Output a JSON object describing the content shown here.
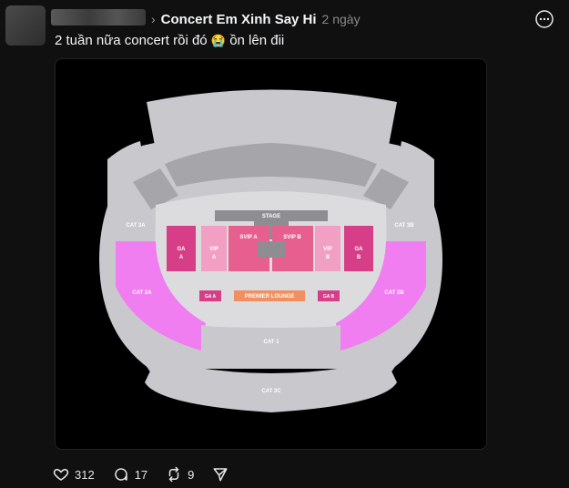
{
  "post": {
    "group_name": "Concert Em Xinh Say Hi",
    "time_ago": "2 ngày",
    "caption_before": "2 tuần nữa concert rồi đó",
    "caption_emoji": "😭",
    "caption_after": " ồn lên đii"
  },
  "seatmap": {
    "stage": "STAGE",
    "svip_a": "SVIP A",
    "svip_b": "SVIP B",
    "vip_a_1": "VIP",
    "vip_a_2": "A",
    "vip_b_1": "VIP",
    "vip_b_2": "B",
    "ga_a_1": "GA",
    "ga_a_2": "A",
    "ga_b_1": "GA",
    "ga_b_2": "B",
    "ga_a_small": "GA A",
    "ga_b_small": "GA B",
    "premier_lounge": "PREMIER LOUNGE",
    "cat_3a": "CAT 3A",
    "cat_3b": "CAT 3B",
    "cat_2a": "CAT 2A",
    "cat_2b": "CAT 2B",
    "cat_1": "CAT 1",
    "cat_3c": "CAT 3C"
  },
  "stats": {
    "likes": "312",
    "comments": "17",
    "reposts": "9"
  },
  "colors": {
    "bg": "#101010",
    "gray": "#c9c9cd",
    "dark_gray": "#9a9a9e",
    "pink": "#f07ef0",
    "magenta": "#d63f88",
    "lounge": "#f09060"
  }
}
